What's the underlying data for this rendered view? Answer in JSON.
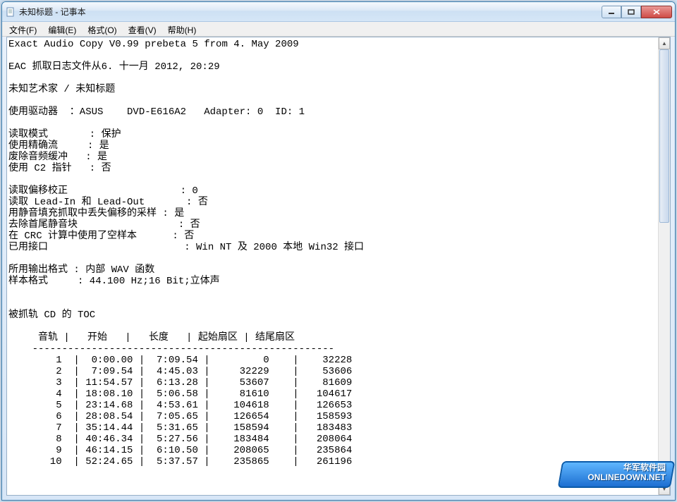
{
  "window": {
    "title": "未知标题 - 记事本"
  },
  "menu": {
    "file": "文件(F)",
    "edit": "编辑(E)",
    "format": "格式(O)",
    "view": "查看(V)",
    "help": "帮助(H)"
  },
  "body": {
    "l01": "Exact Audio Copy V0.99 prebeta 5 from 4. May 2009",
    "l02": "",
    "l03": "EAC 抓取日志文件从6. 十一月 2012, 20:29",
    "l04": "",
    "l05": "未知艺术家 / 未知标题",
    "l06": "",
    "l07": "使用驱动器  ：ASUS    DVD-E616A2   Adapter: 0  ID: 1",
    "l08": "",
    "l09": "读取模式       : 保护",
    "l10": "使用精确流     : 是",
    "l11": "废除音频缓冲   : 是",
    "l12": "使用 C2 指针   : 否",
    "l13": "",
    "l14": "读取偏移校正                   : 0",
    "l15": "读取 Lead-In 和 Lead-Out       : 否",
    "l16": "用静音填充抓取中丢失偏移的采样 : 是",
    "l17": "去除首尾静音块                 : 否",
    "l18": "在 CRC 计算中使用了空样本      : 否",
    "l19": "已用接口                       : Win NT 及 2000 本地 Win32 接口",
    "l20": "",
    "l21": "所用输出格式 : 内部 WAV 函数",
    "l22": "样本格式     : 44.100 Hz;16 Bit;立体声",
    "l23": "",
    "l24": "",
    "l25": "被抓轨 CD 的 TOC",
    "l26": "",
    "l27": "     音轨 |   开始   |   长度   | 起始扇区 | 结尾扇区 ",
    "l28": "    ---------------------------------------------------",
    "l29": "        1  |  0:00.00 |  7:09.54 |         0    |    32228   ",
    "l30": "        2  |  7:09.54 |  4:45.03 |     32229    |    53606   ",
    "l31": "        3  | 11:54.57 |  6:13.28 |     53607    |    81609   ",
    "l32": "        4  | 18:08.10 |  5:06.58 |     81610    |   104617   ",
    "l33": "        5  | 23:14.68 |  4:53.61 |    104618    |   126653   ",
    "l34": "        6  | 28:08.54 |  7:05.65 |    126654    |   158593   ",
    "l35": "        7  | 35:14.44 |  5:31.65 |    158594    |   183483   ",
    "l36": "        8  | 40:46.34 |  5:27.56 |    183484    |   208064   ",
    "l37": "        9  | 46:14.15 |  6:10.50 |    208065    |   235864   ",
    "l38": "       10  | 52:24.65 |  5:37.57 |    235865    |   261196   "
  },
  "watermark": {
    "line1": "华军软件园",
    "line2": "ONLINEDOWN.NET"
  },
  "chart_data": {
    "type": "table",
    "title": "被抓轨 CD 的 TOC",
    "columns": [
      "音轨",
      "开始",
      "长度",
      "起始扇区",
      "结尾扇区"
    ],
    "rows": [
      [
        1,
        "0:00.00",
        "7:09.54",
        0,
        32228
      ],
      [
        2,
        "7:09.54",
        "4:45.03",
        32229,
        53606
      ],
      [
        3,
        "11:54.57",
        "6:13.28",
        53607,
        81609
      ],
      [
        4,
        "18:08.10",
        "5:06.58",
        81610,
        104617
      ],
      [
        5,
        "23:14.68",
        "4:53.61",
        104618,
        126653
      ],
      [
        6,
        "28:08.54",
        "7:05.65",
        126654,
        158593
      ],
      [
        7,
        "35:14.44",
        "5:31.65",
        158594,
        183483
      ],
      [
        8,
        "40:46.34",
        "5:27.56",
        183484,
        208064
      ],
      [
        9,
        "46:14.15",
        "6:10.50",
        208065,
        235864
      ],
      [
        10,
        "52:24.65",
        "5:37.57",
        235865,
        261196
      ]
    ]
  }
}
